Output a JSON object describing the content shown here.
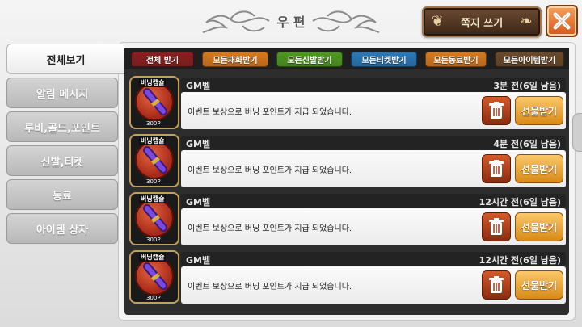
{
  "header": {
    "title": "우 편",
    "write_label": "쪽지 쓰기"
  },
  "tabs": [
    {
      "label": "전체보기",
      "active": true
    },
    {
      "label": "알림 메시지",
      "active": false
    },
    {
      "label": "루비,골드,포인트",
      "active": false
    },
    {
      "label": "신발,티켓",
      "active": false
    },
    {
      "label": "동료",
      "active": false
    },
    {
      "label": "아이템 상자",
      "active": false
    }
  ],
  "filters": [
    {
      "label": "전체 받기",
      "color": "#8a1f1f"
    },
    {
      "label": "모든재화받기",
      "color": "#d97a1e"
    },
    {
      "label": "모든신발받기",
      "color": "#4e9a1f"
    },
    {
      "label": "모든티켓받기",
      "color": "#2b79b8"
    },
    {
      "label": "모든동료받기",
      "color": "#d97a1e"
    },
    {
      "label": "모든아이템받기",
      "color": "#6b4a2a"
    }
  ],
  "mails": [
    {
      "item_label": "버닝캡슐",
      "item_price": "300P",
      "sender": "GM벨",
      "time": "3분 전(6일 남음)",
      "message": "이벤트 보상으로 버닝 포인트가 지급 되었습니다.",
      "receive_label": "선물받기"
    },
    {
      "item_label": "버닝캡슐",
      "item_price": "300P",
      "sender": "GM벨",
      "time": "4분 전(6일 남음)",
      "message": "이벤트 보상으로 버닝 포인트가 지급 되었습니다.",
      "receive_label": "선물받기"
    },
    {
      "item_label": "버닝캡슐",
      "item_price": "300P",
      "sender": "GM벨",
      "time": "12시간 전(6일 남음)",
      "message": "이벤트 보상으로 버닝 포인트가 지급 되었습니다.",
      "receive_label": "선물받기"
    },
    {
      "item_label": "버닝캡슐",
      "item_price": "300P",
      "sender": "GM벨",
      "time": "12시간 전(6일 남음)",
      "message": "이벤트 보상으로 버닝 포인트가 지급 되었습니다.",
      "receive_label": "선물받기"
    }
  ]
}
